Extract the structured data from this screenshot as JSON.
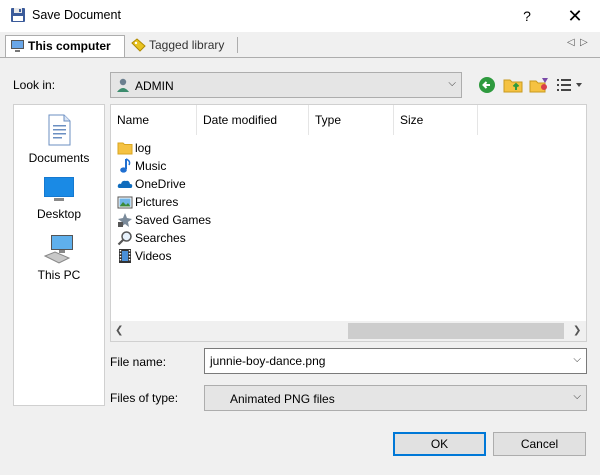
{
  "window": {
    "title": "Save Document",
    "help_glyph": "?",
    "close_glyph": "✕"
  },
  "tabs": [
    {
      "label": "This computer",
      "icon": "computer-icon",
      "active": true
    },
    {
      "label": "Tagged library",
      "icon": "tag-icon",
      "active": false
    }
  ],
  "tab_nav": {
    "prev_glyph": "◁",
    "next_glyph": "▷"
  },
  "look_in": {
    "label": "Look in:",
    "value": "ADMIN",
    "icon": "user-folder-icon"
  },
  "toolbar": {
    "back_icon": "back-arrow-icon",
    "up_icon": "up-folder-icon",
    "new_folder_icon": "new-folder-icon",
    "view_menu_icon": "view-menu-icon"
  },
  "places": [
    {
      "label": "Documents",
      "icon": "documents-icon"
    },
    {
      "label": "Desktop",
      "icon": "desktop-icon"
    },
    {
      "label": "This PC",
      "icon": "this-pc-icon"
    }
  ],
  "file_list": {
    "columns": [
      "Name",
      "Date modified",
      "Type",
      "Size"
    ],
    "items": [
      {
        "name": "log",
        "icon": "folder-icon"
      },
      {
        "name": "Music",
        "icon": "music-icon"
      },
      {
        "name": "OneDrive",
        "icon": "onedrive-icon"
      },
      {
        "name": "Pictures",
        "icon": "pictures-icon"
      },
      {
        "name": "Saved Games",
        "icon": "saved-games-icon"
      },
      {
        "name": "Searches",
        "icon": "search-icon"
      },
      {
        "name": "Videos",
        "icon": "videos-icon"
      }
    ]
  },
  "file_name": {
    "label": "File name:",
    "value": "junnie-boy-dance.png"
  },
  "file_type": {
    "label": "Files of type:",
    "value": "Animated PNG files"
  },
  "buttons": {
    "ok": "OK",
    "cancel": "Cancel"
  },
  "colors": {
    "accent": "#0078d7",
    "folder": "#f5c242",
    "background": "#f0f0f0"
  }
}
